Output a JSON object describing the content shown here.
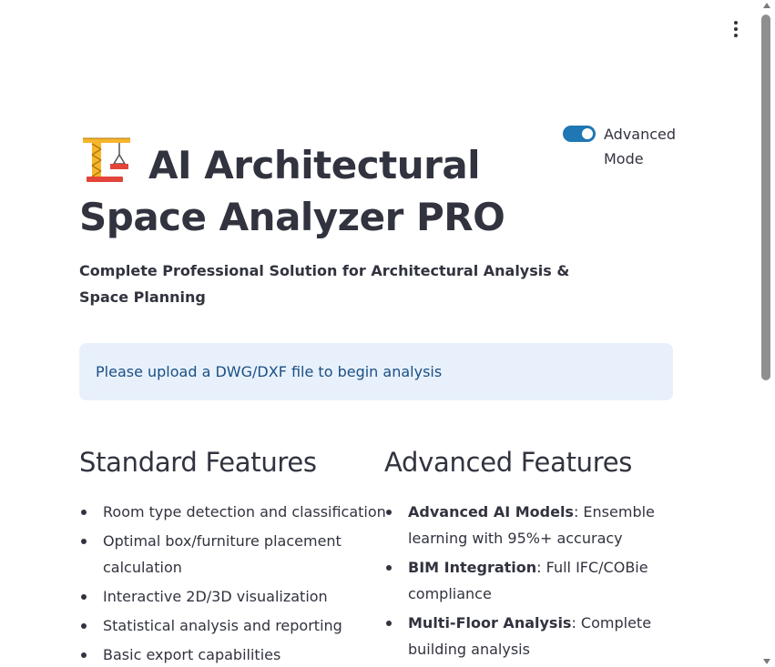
{
  "header": {
    "title": "AI Architectural Space Analyzer PRO",
    "title_icon": "building-construction-crane-icon",
    "subtitle": "Complete Professional Solution for Architectural Analysis & Space Planning"
  },
  "toggle": {
    "label": "Advanced Mode",
    "state": "on",
    "accent_color": "#1f77b4"
  },
  "info_box": {
    "text": "Please upload a DWG/DXF file to begin analysis",
    "background": "#e8f1fb",
    "text_color": "#1b4f86"
  },
  "standard_features": {
    "heading": "Standard Features",
    "items": [
      "Room type detection and classification",
      "Optimal box/furniture placement calculation",
      "Interactive 2D/3D visualization",
      "Statistical analysis and reporting",
      "Basic export capabilities"
    ]
  },
  "advanced_features": {
    "heading": "Advanced Features",
    "items": [
      {
        "label": "Advanced AI Models",
        "text": ": Ensemble learning with 95%+ accuracy"
      },
      {
        "label": "BIM Integration",
        "text": ": Full IFC/COBie compliance"
      },
      {
        "label": "Multi-Floor Analysis",
        "text": ": Complete building analysis"
      }
    ]
  },
  "main_menu": {
    "icon": "vertical-ellipsis-icon"
  }
}
